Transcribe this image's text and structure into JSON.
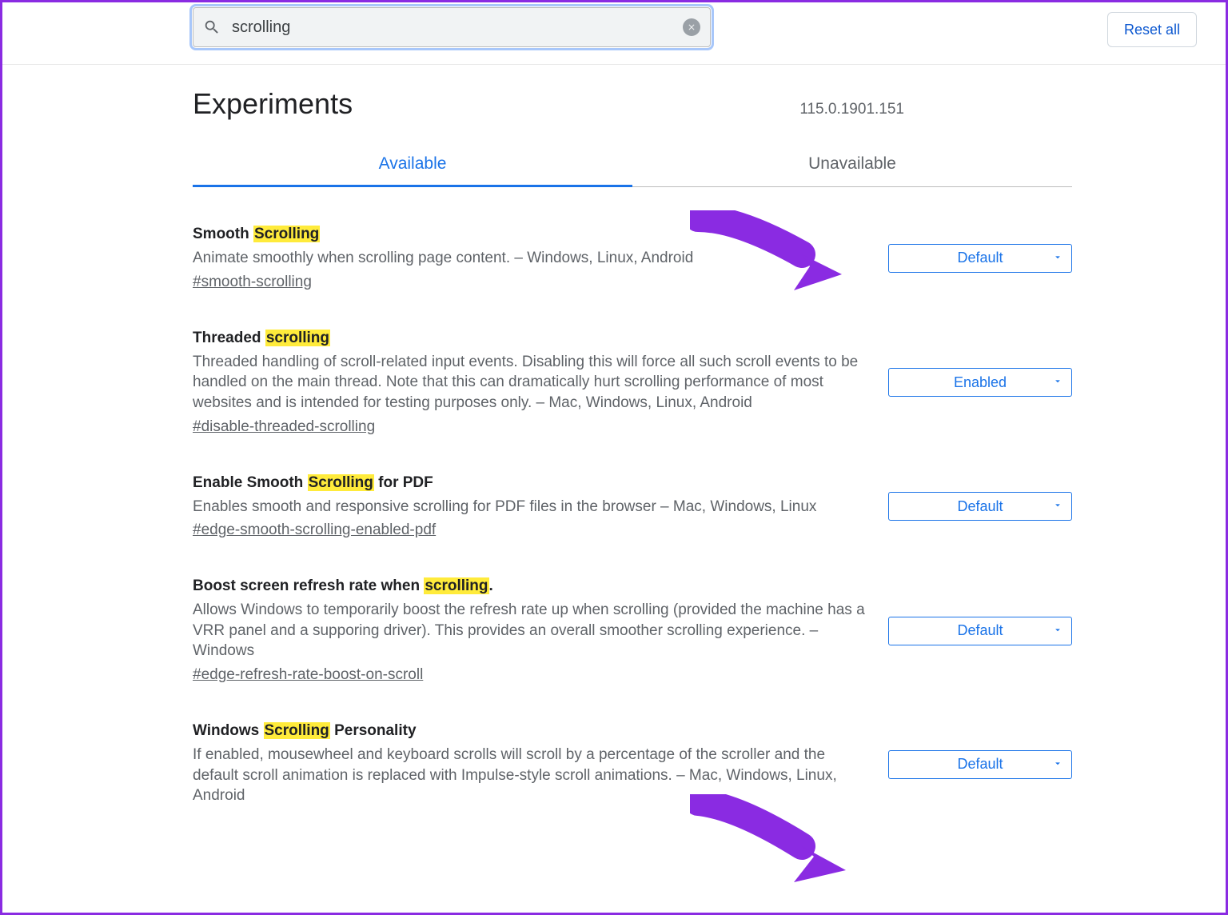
{
  "search": {
    "value": "scrolling"
  },
  "reset_label": "Reset all",
  "page_title": "Experiments",
  "version": "115.0.1901.151",
  "tabs": {
    "available": "Available",
    "unavailable": "Unavailable"
  },
  "flags": [
    {
      "title_pre": "Smooth ",
      "title_hl": "Scrolling",
      "title_post": "",
      "desc": "Animate smoothly when scrolling page content. – Windows, Linux, Android",
      "link": "#smooth-scrolling",
      "select": "Default"
    },
    {
      "title_pre": "Threaded ",
      "title_hl": "scrolling",
      "title_post": "",
      "desc": "Threaded handling of scroll-related input events. Disabling this will force all such scroll events to be handled on the main thread. Note that this can dramatically hurt scrolling performance of most websites and is intended for testing purposes only. – Mac, Windows, Linux, Android",
      "link": "#disable-threaded-scrolling",
      "select": "Enabled"
    },
    {
      "title_pre": "Enable Smooth ",
      "title_hl": "Scrolling",
      "title_post": " for PDF",
      "desc": "Enables smooth and responsive scrolling for PDF files in the browser – Mac, Windows, Linux",
      "link": "#edge-smooth-scrolling-enabled-pdf",
      "select": "Default"
    },
    {
      "title_pre": "Boost screen refresh rate when ",
      "title_hl": "scrolling",
      "title_post": ".",
      "desc": "Allows Windows to temporarily boost the refresh rate up when scrolling (provided the machine has a VRR panel and a supporing driver). This provides an overall smoother scrolling experience. – Windows",
      "link": "#edge-refresh-rate-boost-on-scroll",
      "select": "Default"
    },
    {
      "title_pre": "Windows ",
      "title_hl": "Scrolling",
      "title_post": " Personality",
      "desc": "If enabled, mousewheel and keyboard scrolls will scroll by a percentage of the scroller and the default scroll animation is replaced with Impulse-style scroll animations. – Mac, Windows, Linux, Android",
      "link": "",
      "select": "Default"
    }
  ]
}
